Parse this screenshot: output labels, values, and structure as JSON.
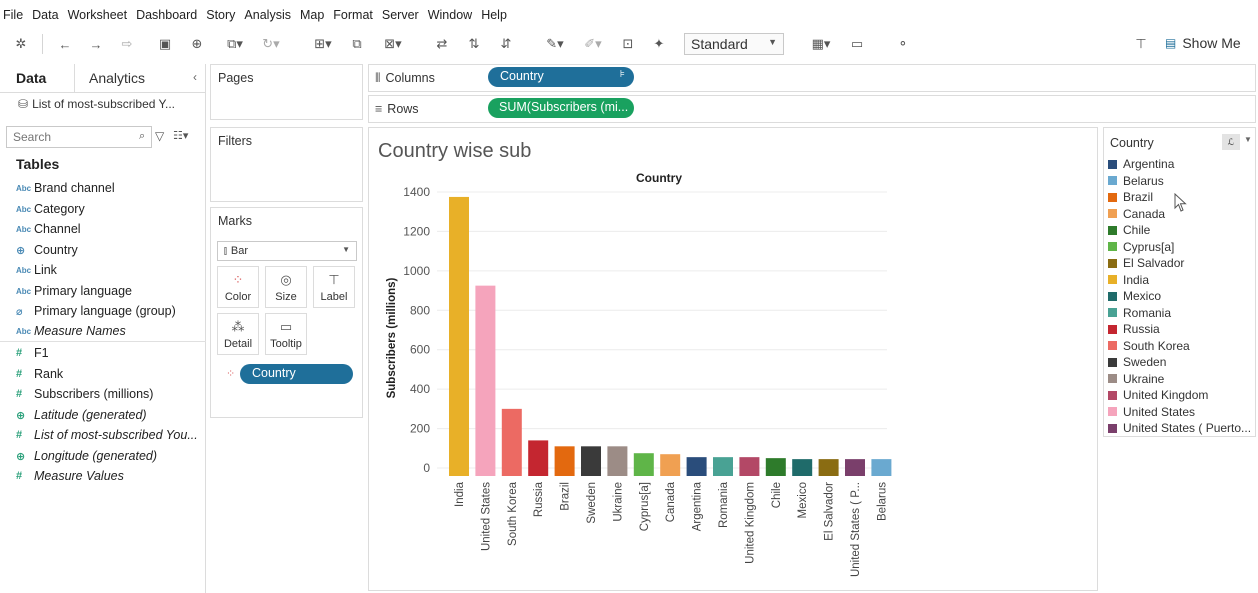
{
  "menu": [
    "File",
    "Data",
    "Worksheet",
    "Dashboard",
    "Story",
    "Analysis",
    "Map",
    "Format",
    "Server",
    "Window",
    "Help"
  ],
  "toolbar": {
    "standard": "Standard",
    "show_me": "Show Me"
  },
  "left_pane": {
    "tab_data": "Data",
    "tab_analytics": "Analytics",
    "datasource": "List of most-subscribed Y...",
    "search_placeholder": "Search",
    "tables_heading": "Tables",
    "fields": [
      {
        "label": "Brand channel",
        "type": "dim"
      },
      {
        "label": "Category",
        "type": "dim"
      },
      {
        "label": "Channel",
        "type": "dim"
      },
      {
        "label": "Country",
        "type": "geo-dim"
      },
      {
        "label": "Link",
        "type": "dim"
      },
      {
        "label": "Primary language",
        "type": "dim"
      },
      {
        "label": "Primary language (group)",
        "type": "group"
      },
      {
        "label": "Measure Names",
        "type": "dim-italic"
      }
    ],
    "measures": [
      {
        "label": "F1",
        "type": "meas"
      },
      {
        "label": "Rank",
        "type": "meas"
      },
      {
        "label": "Subscribers (millions)",
        "type": "meas"
      },
      {
        "label": "Latitude (generated)",
        "type": "geo-italic"
      },
      {
        "label": "List of most-subscribed You...",
        "type": "meas-italic"
      },
      {
        "label": "Longitude (generated)",
        "type": "geo-italic"
      },
      {
        "label": "Measure Values",
        "type": "meas-italic"
      }
    ]
  },
  "cards": {
    "pages": "Pages",
    "filters": "Filters",
    "marks": "Marks",
    "marks_type": "Bar",
    "mark_buttons": [
      "Color",
      "Size",
      "Label",
      "Detail",
      "Tooltip"
    ],
    "marks_pill": "Country"
  },
  "shelves": {
    "columns_label": "Columns",
    "columns_pill": "Country",
    "rows_label": "Rows",
    "rows_pill": "SUM(Subscribers (mi..."
  },
  "viz": {
    "title": "Country wise sub"
  },
  "chart_data": {
    "type": "bar",
    "title": "Country",
    "xlabel": "",
    "ylabel": "Subscribers (millions)",
    "ylim": [
      0,
      1400
    ],
    "yticks": [
      0,
      200,
      400,
      600,
      800,
      1000,
      1200,
      1400
    ],
    "categories": [
      "India",
      "United States",
      "South Korea",
      "Russia",
      "Brazil",
      "Sweden",
      "Ukraine",
      "Cyprus[a]",
      "Canada",
      "Argentina",
      "Romania",
      "United Kingdom",
      "Chile",
      "Mexico",
      "El Salvador",
      "United States ( P...",
      "Belarus"
    ],
    "values": [
      1375,
      925,
      300,
      140,
      110,
      110,
      110,
      75,
      70,
      55,
      55,
      55,
      50,
      45,
      45,
      45,
      45
    ],
    "colors": [
      "#E8B028",
      "#F5A4BC",
      "#EC6A63",
      "#C42630",
      "#E3690F",
      "#3A3A3A",
      "#9C8C86",
      "#5FB548",
      "#F0A052",
      "#2A4D7B",
      "#49A294",
      "#B34866",
      "#2E7B2B",
      "#1F6B6A",
      "#8A6C12",
      "#7A3F6B",
      "#6AA9D0"
    ],
    "grid": true
  },
  "legend": {
    "title": "Country",
    "items": [
      {
        "label": "Argentina",
        "color": "#2A4D7B"
      },
      {
        "label": "Belarus",
        "color": "#6AA9D0"
      },
      {
        "label": "Brazil",
        "color": "#E3690F"
      },
      {
        "label": "Canada",
        "color": "#F0A052"
      },
      {
        "label": "Chile",
        "color": "#2E7B2B"
      },
      {
        "label": "Cyprus[a]",
        "color": "#5FB548"
      },
      {
        "label": "El Salvador",
        "color": "#8A6C12"
      },
      {
        "label": "India",
        "color": "#E8B028"
      },
      {
        "label": "Mexico",
        "color": "#1F6B6A"
      },
      {
        "label": "Romania",
        "color": "#49A294"
      },
      {
        "label": "Russia",
        "color": "#C42630"
      },
      {
        "label": "South Korea",
        "color": "#EC6A63"
      },
      {
        "label": "Sweden",
        "color": "#3A3A3A"
      },
      {
        "label": "Ukraine",
        "color": "#9C8C86"
      },
      {
        "label": "United Kingdom",
        "color": "#B34866"
      },
      {
        "label": "United States",
        "color": "#F5A4BC"
      },
      {
        "label": "United States ( Puerto...",
        "color": "#7A3F6B"
      }
    ]
  }
}
